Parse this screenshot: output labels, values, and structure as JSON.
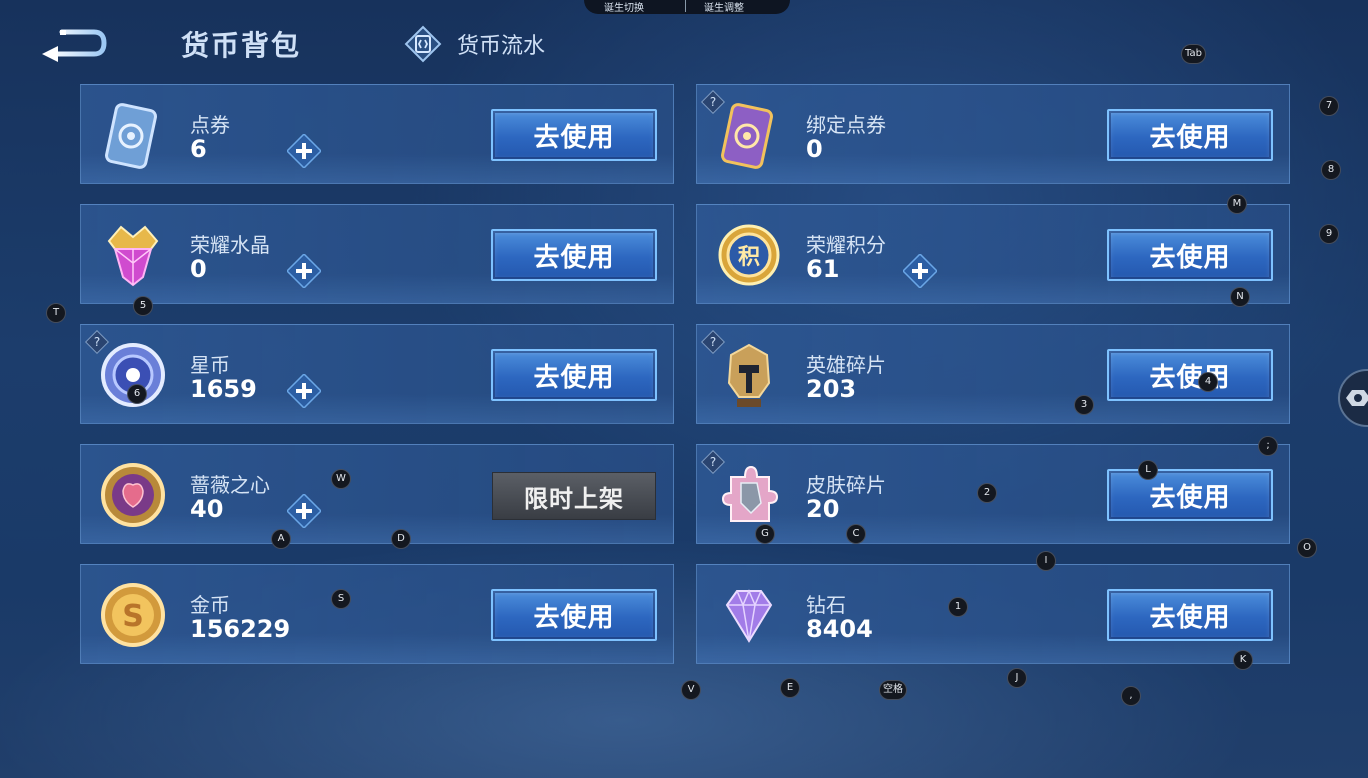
{
  "header": {
    "title": "货币背包",
    "tabs": [
      {
        "label": "货币流水"
      }
    ]
  },
  "top_pill": {
    "left_label": "诞生切换",
    "right_label": "诞生调整"
  },
  "cards": [
    {
      "id": "dianjuan",
      "name": "点券",
      "amount": "6",
      "has_plus": true,
      "has_help": false,
      "button": "去使用"
    },
    {
      "id": "bangding",
      "name": "绑定点券",
      "amount": "0",
      "has_plus": false,
      "has_help": true,
      "button": "去使用"
    },
    {
      "id": "shuijing",
      "name": "荣耀水晶",
      "amount": "0",
      "has_plus": true,
      "has_help": false,
      "button": "去使用"
    },
    {
      "id": "jifen",
      "name": "荣耀积分",
      "amount": "61",
      "has_plus": true,
      "has_help": false,
      "button": "去使用"
    },
    {
      "id": "xingbi",
      "name": "星币",
      "amount": "1659",
      "has_plus": true,
      "has_help": true,
      "button": "去使用"
    },
    {
      "id": "yingxiong",
      "name": "英雄碎片",
      "amount": "203",
      "has_plus": false,
      "has_help": true,
      "button": "去使用"
    },
    {
      "id": "qiangwei",
      "name": "蔷薇之心",
      "amount": "40",
      "has_plus": true,
      "has_help": false,
      "button": "限时上架"
    },
    {
      "id": "pifu",
      "name": "皮肤碎片",
      "amount": "20",
      "has_plus": false,
      "has_help": true,
      "button": "去使用"
    },
    {
      "id": "jinbi",
      "name": "金币",
      "amount": "156229",
      "has_plus": false,
      "has_help": false,
      "button": "去使用"
    },
    {
      "id": "zuanshi",
      "name": "钻石",
      "amount": "8404",
      "has_plus": false,
      "has_help": false,
      "button": "去使用"
    }
  ],
  "key_hints": [
    "Tab",
    "7",
    "8",
    "M",
    "9",
    "N",
    "T",
    "5",
    "6",
    "3",
    "4",
    ";",
    "L",
    "W",
    "2",
    "A",
    "D",
    "G",
    "C",
    "O",
    "I",
    "S",
    "1",
    "K",
    "V",
    "E",
    "空格",
    "J",
    ","
  ],
  "colors": {
    "accent_button": "#2d67c0",
    "button_border": "#7ec2ff",
    "background": "#1c3d6c"
  }
}
